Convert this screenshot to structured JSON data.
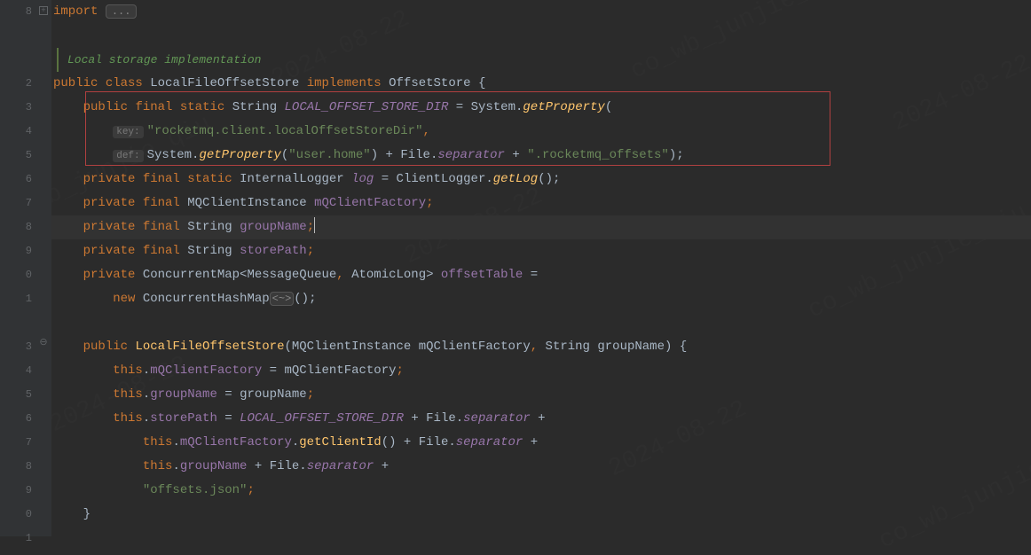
{
  "watermarks": [
    "2024-08-22",
    "co_wb_junjie_qiu"
  ],
  "gutter": {
    "lines": [
      "8",
      "",
      "",
      "2",
      "3",
      "4",
      "5",
      "6",
      "7",
      "8",
      "9",
      "0",
      "1",
      "",
      "3",
      "4",
      "5",
      "6",
      "7",
      "8",
      "9",
      "0",
      "1"
    ]
  },
  "code": {
    "import_kw": "import",
    "import_folded": "...",
    "comment": "Local storage implementation",
    "l1": {
      "public": "public",
      "class": "class",
      "name": "LocalFileOffsetStore",
      "implements": "implements",
      "iface": "OffsetStore",
      "brace": "{"
    },
    "l2": {
      "public": "public",
      "final": "final",
      "static": "static",
      "type": "String",
      "field": "LOCAL_OFFSET_STORE_DIR",
      "eq": "=",
      "sys": "System",
      "dot": ".",
      "method": "getProperty",
      "paren": "("
    },
    "l3": {
      "inlay": "key:",
      "str": "\"rocketmq.client.localOffsetStoreDir\"",
      "comma": ","
    },
    "l4": {
      "inlay": "def:",
      "sys": "System",
      "dot": ".",
      "method": "getProperty",
      "lp": "(",
      "str1": "\"user.home\"",
      "rp": ")",
      "plus": " + ",
      "file": "File",
      "sep": "separator",
      "plus2": " + ",
      "str2": "\".rocketmq_offsets\"",
      "end": ");"
    },
    "l5": {
      "private": "private",
      "final": "final",
      "static": "static",
      "type": "InternalLogger",
      "field": "log",
      "eq": "=",
      "cl": "ClientLogger",
      "dot": ".",
      "method": "getLog",
      "end": "();"
    },
    "l6": {
      "private": "private",
      "final": "final",
      "type": "MQClientInstance",
      "field": "mQClientFactory",
      "semi": ";"
    },
    "l7": {
      "private": "private",
      "final": "final",
      "type": "String",
      "field": "groupName",
      "semi": ";"
    },
    "l8": {
      "private": "private",
      "final": "final",
      "type": "String",
      "field": "storePath",
      "semi": ";"
    },
    "l9": {
      "private": "private",
      "type": "ConcurrentMap",
      "lt": "<",
      "t1": "MessageQueue",
      "comma": ",",
      "sp": " ",
      "t2": "AtomicLong",
      "gt": ">",
      "field": "offsetTable",
      "eq": "="
    },
    "l10": {
      "new": "new",
      "type": "ConcurrentHashMap",
      "diamond": "<~>",
      "end": "();"
    },
    "l11": {
      "public": "public",
      "ctor": "LocalFileOffsetStore",
      "lp": "(",
      "t1": "MQClientInstance",
      "p1": "mQClientFactory",
      "comma": ",",
      "t2": "String",
      "p2": "groupName",
      "rp": ")",
      "brace": "{"
    },
    "l12": {
      "this": "this",
      "dot": ".",
      "f": "mQClientFactory",
      "eq": "=",
      "p": "mQClientFactory",
      "semi": ";"
    },
    "l13": {
      "this": "this",
      "dot": ".",
      "f": "groupName",
      "eq": "=",
      "p": "groupName",
      "semi": ";"
    },
    "l14": {
      "this": "this",
      "dot": ".",
      "f": "storePath",
      "eq": "=",
      "c": "LOCAL_OFFSET_STORE_DIR",
      "plus": " + ",
      "file": "File",
      "sep": "separator",
      "plus2": " +"
    },
    "l15": {
      "this": "this",
      "dot": ".",
      "f": "mQClientFactory",
      "dot2": ".",
      "m": "getClientId",
      "call": "()",
      "plus": " + ",
      "file": "File",
      "sep": "separator",
      "plus2": " +"
    },
    "l16": {
      "this": "this",
      "dot": ".",
      "f": "groupName",
      "plus": " + ",
      "file": "File",
      "sep": "separator",
      "plus2": " +"
    },
    "l17": {
      "str": "\"offsets.json\"",
      "semi": ";"
    },
    "l18": {
      "brace": "}"
    }
  }
}
